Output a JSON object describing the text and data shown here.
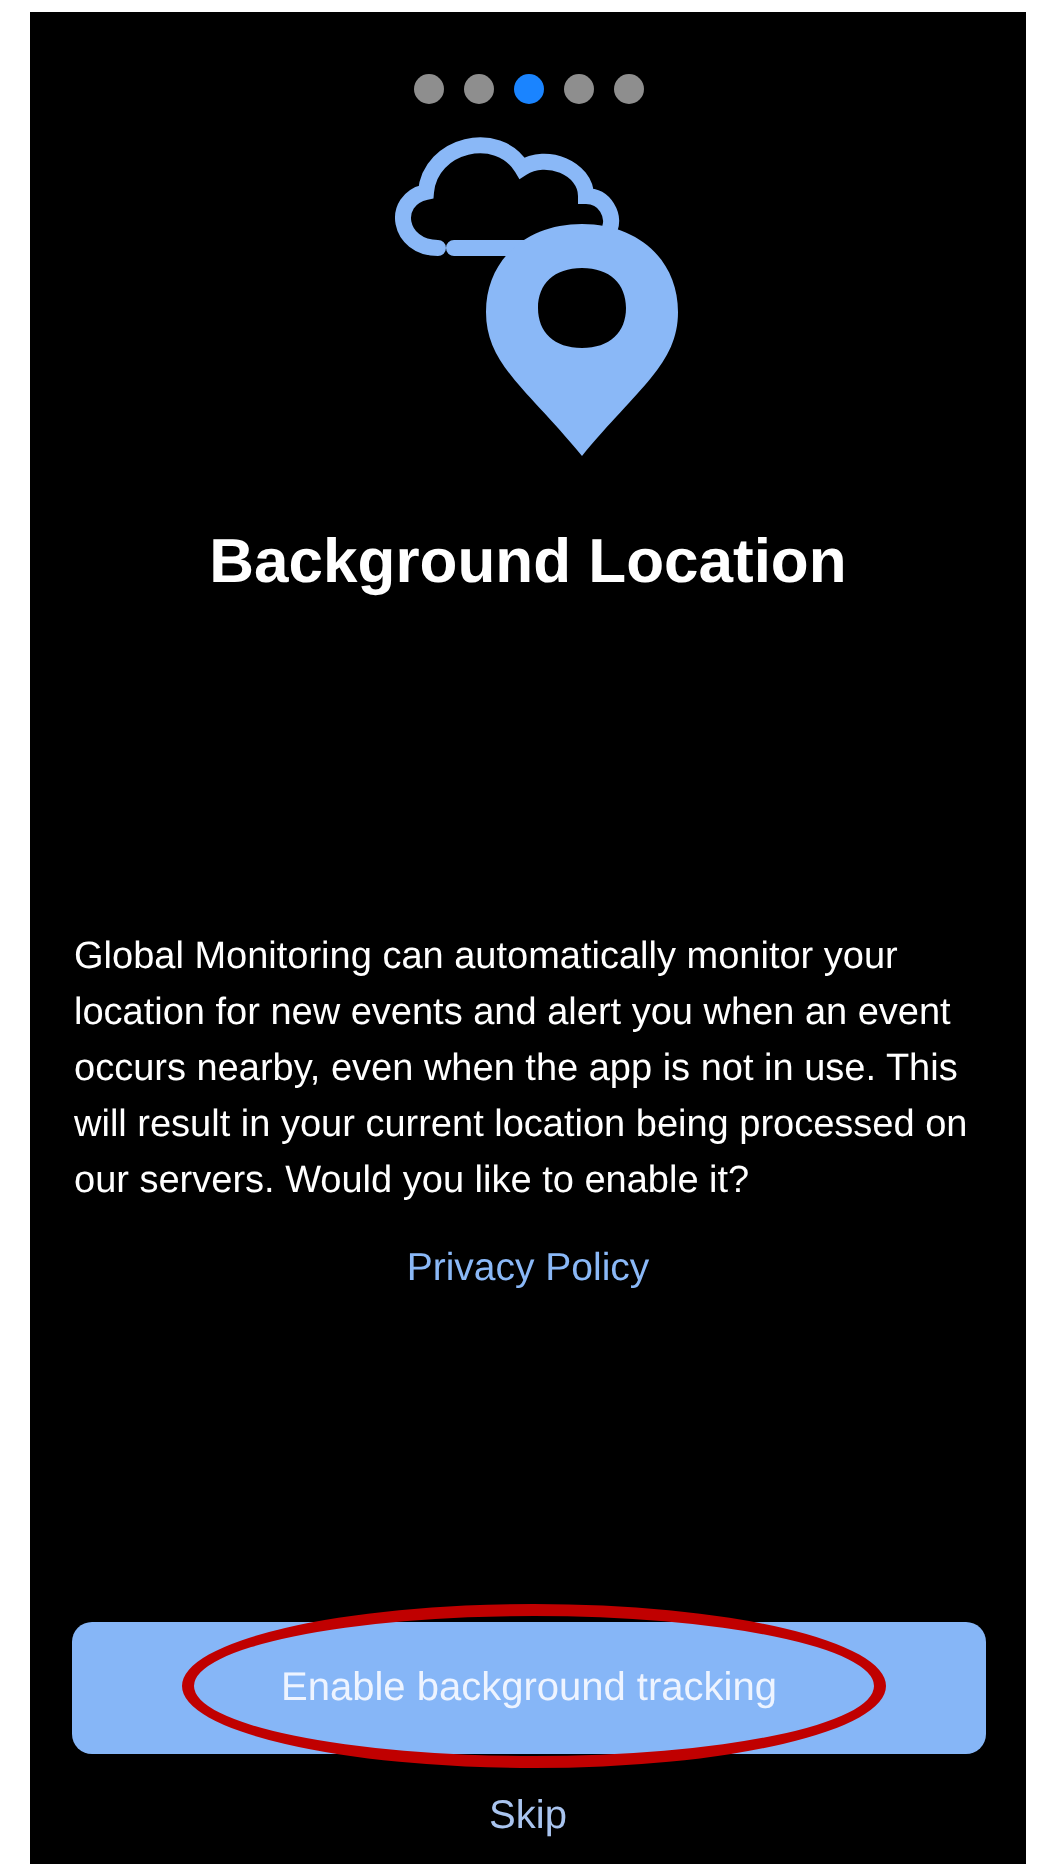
{
  "pager": {
    "dots": [
      {
        "selected": false
      },
      {
        "selected": false
      },
      {
        "selected": true
      },
      {
        "selected": false
      },
      {
        "selected": false
      }
    ]
  },
  "title": "Background Location",
  "description": "Global Monitoring can automatically monitor your location for new events and alert you when an event occurs nearby, even when the app is not in use. This will result in your current location being processed on our servers. Would you like to enable it?",
  "privacy_link": "Privacy Policy",
  "primary_button": {
    "label": "Enable background tracking",
    "circled": true
  },
  "skip_link": "Skip"
}
